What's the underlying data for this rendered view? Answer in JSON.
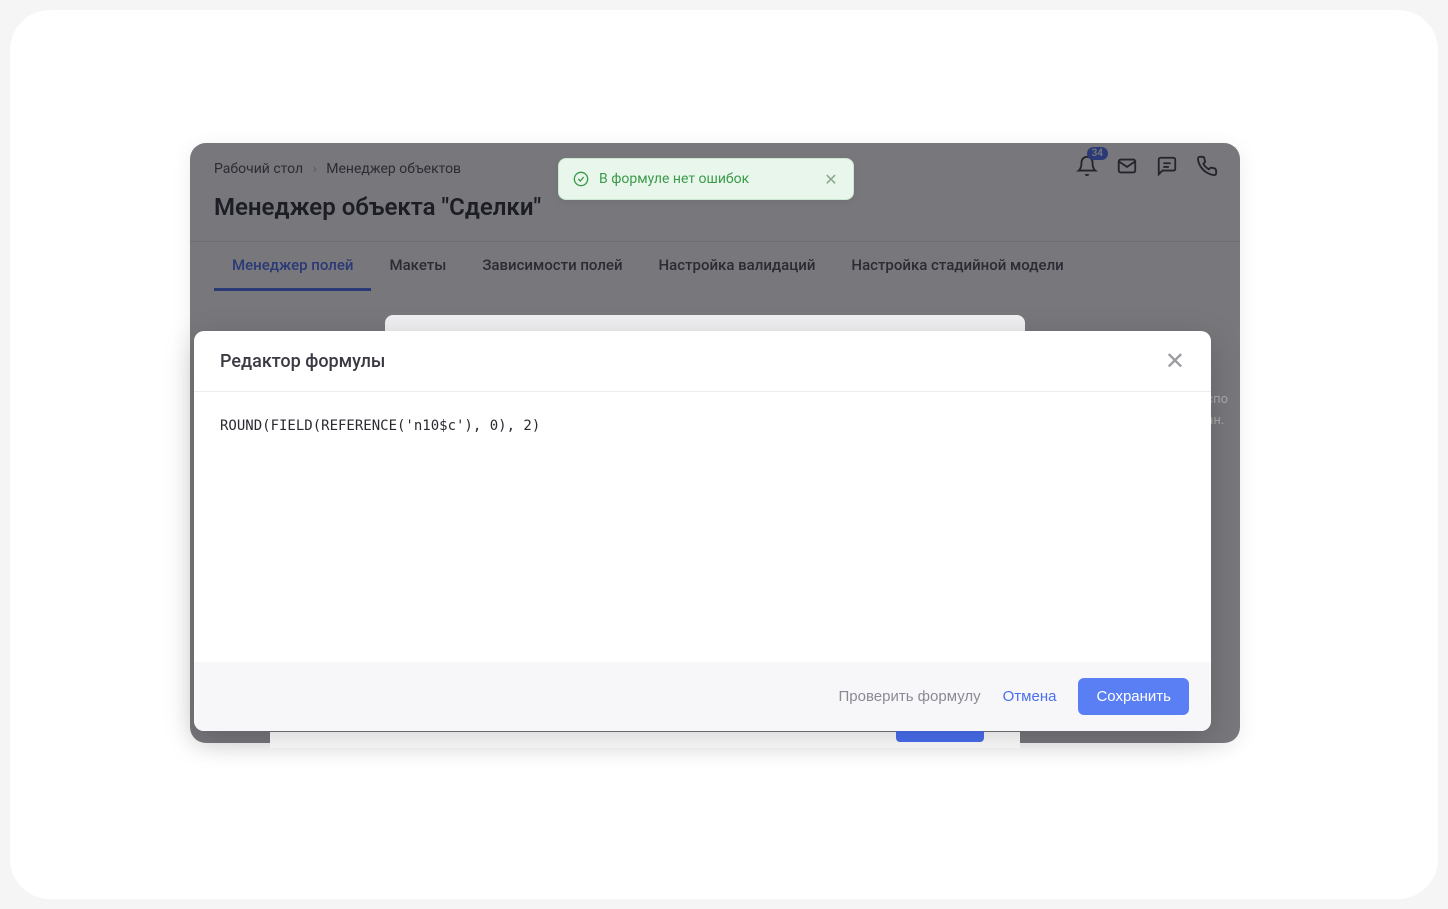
{
  "breadcrumb": {
    "item1": "Рабочий стол",
    "item2": "Менеджер объектов"
  },
  "page_title": "Менеджер объекта \"Сделки\"",
  "tabs": {
    "field_manager": "Менеджер полей",
    "layouts": "Макеты",
    "dependencies": "Зависимости полей",
    "validations": "Настройка валидаций",
    "stage_model": "Настройка стадийной модели"
  },
  "notification_badge": "34",
  "toast": {
    "message": "В формуле нет ошибок"
  },
  "modal": {
    "title": "Редактор формулы",
    "formula": "ROUND(FIELD(REFERENCE('n10$c'), 0), 2)",
    "check_label": "Проверить формулу",
    "cancel_label": "Отмена",
    "save_label": "Сохранить"
  },
  "side_text": {
    "l1": "спо",
    "l2": "ан."
  }
}
